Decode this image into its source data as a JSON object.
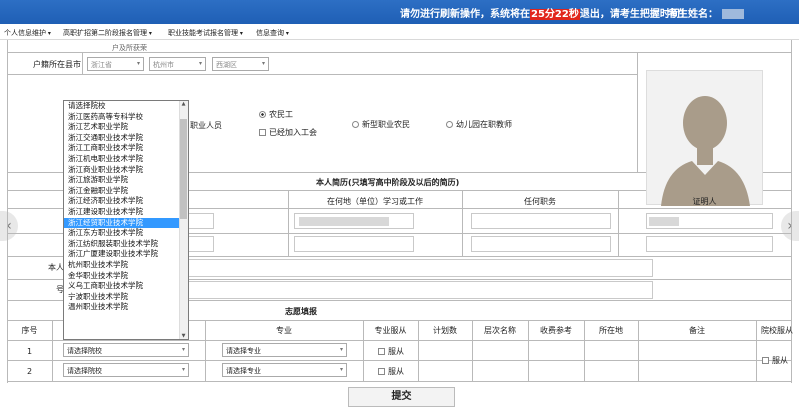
{
  "topbar": {
    "warning_prefix": "请勿进行刷新操作，系统将在",
    "countdown": "25分22秒",
    "warning_suffix": "退出，请考生把握时间！",
    "student_label": "考生姓名：",
    "colors": {
      "bar": "#2266bb",
      "timer_bg": "#e1251b"
    }
  },
  "nav": {
    "items": [
      "个人信息维护",
      "高职扩招第二阶段报名管理",
      "职业技能考试报名管理",
      "信息查询"
    ]
  },
  "form": {
    "top_partial": "户及所获荣",
    "hukou_label": "户籍所在县市",
    "province": "浙江省",
    "city": "杭州市",
    "district": "西湖区",
    "category_partial": "职业人员",
    "options": {
      "migrant_worker": "农民工",
      "new_farmer": "新型职业农民",
      "kindergarten_teacher": "幼儿园在职教师",
      "joined_union": "已经加入工会"
    },
    "self_partial_1": "本人",
    "self_partial_2": "号"
  },
  "resume": {
    "title": "本人简历(只填写高中阶段及以后的简历)",
    "columns": [
      "在何地（单位）学习或工作",
      "任何职务",
      "证明人"
    ]
  },
  "volunteer": {
    "title": "志愿填报",
    "columns": [
      "序号",
      "专业",
      "专业服从",
      "计划数",
      "层次名称",
      "收费参考",
      "所在地",
      "备注",
      "院校服从"
    ],
    "rows": [
      {
        "no": "1",
        "school": "请选择院校",
        "major": "请选择专业",
        "obey": "服从"
      },
      {
        "no": "2",
        "school": "请选择院校",
        "major": "请选择专业",
        "obey": "服从"
      }
    ],
    "school_obey": "服从"
  },
  "dropdown": {
    "options": [
      "请选择院校",
      "浙江医药高等专科学校",
      "浙江艺术职业学院",
      "浙江交通职业技术学院",
      "浙江工商职业技术学院",
      "浙江机电职业技术学院",
      "浙江商业职业技术学院",
      "浙江旅游职业学院",
      "浙江金融职业学院",
      "浙江经济职业技术学院",
      "浙江建设职业技术学院",
      "浙江经贸职业技术学院",
      "浙江东方职业技术学院",
      "浙江纺织服装职业技术学院",
      "浙江广厦建设职业技术学院",
      "杭州职业技术学院",
      "金华职业技术学院",
      "义乌工商职业技术学院",
      "宁波职业技术学院",
      "温州职业技术学院"
    ],
    "selected_index": 11
  },
  "submit_label": "提交"
}
